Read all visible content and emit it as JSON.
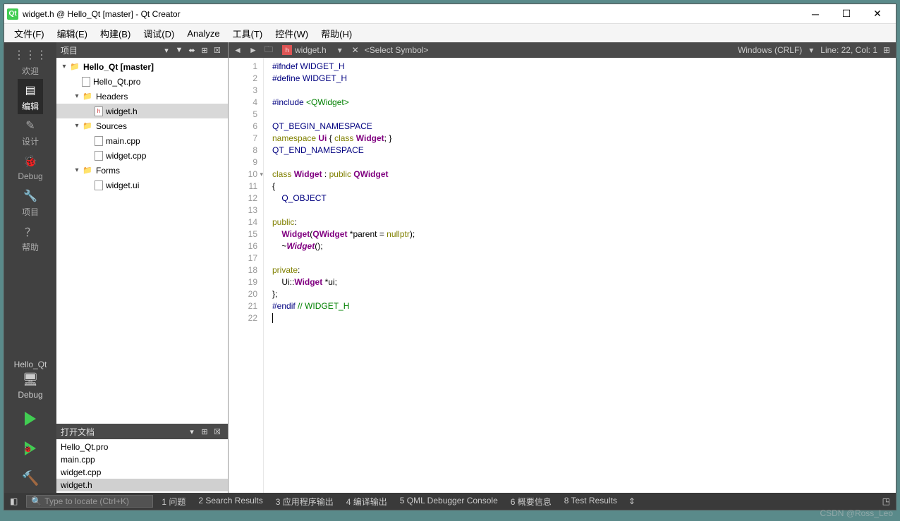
{
  "title": "widget.h @ Hello_Qt [master] - Qt Creator",
  "menus": [
    "文件(F)",
    "编辑(E)",
    "构建(B)",
    "调试(D)",
    "Analyze",
    "工具(T)",
    "控件(W)",
    "帮助(H)"
  ],
  "leftbar": {
    "items": [
      {
        "label": "欢迎",
        "icon": "⋮⋮⋮"
      },
      {
        "label": "编辑",
        "icon": "▤",
        "active": true
      },
      {
        "label": "设计",
        "icon": "✎"
      },
      {
        "label": "Debug",
        "icon": "🐞"
      },
      {
        "label": "项目",
        "icon": "🔧"
      },
      {
        "label": "帮助",
        "icon": "？"
      }
    ],
    "project": "Hello_Qt",
    "config": "Debug"
  },
  "project_panel": {
    "title": "项目",
    "tree": [
      {
        "depth": 0,
        "arrow": "▾",
        "icon": "folder",
        "label": "Hello_Qt [master]",
        "bold": true
      },
      {
        "depth": 1,
        "arrow": "",
        "icon": "file",
        "label": "Hello_Qt.pro"
      },
      {
        "depth": 1,
        "arrow": "▾",
        "icon": "folder",
        "label": "Headers"
      },
      {
        "depth": 2,
        "arrow": "",
        "icon": "hfile",
        "label": "widget.h",
        "selected": true
      },
      {
        "depth": 1,
        "arrow": "▾",
        "icon": "folder",
        "label": "Sources"
      },
      {
        "depth": 2,
        "arrow": "",
        "icon": "file",
        "label": "main.cpp"
      },
      {
        "depth": 2,
        "arrow": "",
        "icon": "file",
        "label": "widget.cpp"
      },
      {
        "depth": 1,
        "arrow": "▾",
        "icon": "folder",
        "label": "Forms"
      },
      {
        "depth": 2,
        "arrow": "",
        "icon": "file",
        "label": "widget.ui"
      }
    ]
  },
  "open_docs": {
    "title": "打开文档",
    "items": [
      "Hello_Qt.pro",
      "main.cpp",
      "widget.cpp",
      "widget.h"
    ],
    "selected": "widget.h"
  },
  "tab": {
    "filename": "widget.h",
    "symbol": "<Select Symbol>",
    "encoding": "Windows (CRLF)",
    "position": "Line: 22, Col: 1"
  },
  "code_lines": [
    {
      "n": 1,
      "html": "<span class='pp'>#ifndef</span><span class='ppk'> WIDGET_H</span>"
    },
    {
      "n": 2,
      "html": "<span class='pp'>#define</span><span class='ppk'> WIDGET_H</span>"
    },
    {
      "n": 3,
      "html": ""
    },
    {
      "n": 4,
      "html": "<span class='pp'>#include</span> <span class='str'>&lt;QWidget&gt;</span>"
    },
    {
      "n": 5,
      "html": ""
    },
    {
      "n": 6,
      "html": "<span class='ppk'>QT_BEGIN_NAMESPACE</span>"
    },
    {
      "n": 7,
      "html": "<span class='kw'>namespace</span> <span class='cls'>Ui</span> { <span class='kw'>class</span> <span class='cls'>Widget</span>; }"
    },
    {
      "n": 8,
      "html": "<span class='ppk'>QT_END_NAMESPACE</span>"
    },
    {
      "n": 9,
      "html": ""
    },
    {
      "n": 10,
      "html": "<span class='kw'>class</span> <span class='cls'>Widget</span> : <span class='kw'>public</span> <span class='cls'>QWidget</span>",
      "fold": true
    },
    {
      "n": 11,
      "html": "{"
    },
    {
      "n": 12,
      "html": "    <span class='ppk'>Q_OBJECT</span>"
    },
    {
      "n": 13,
      "html": ""
    },
    {
      "n": 14,
      "html": "<span class='kw'>public</span>:"
    },
    {
      "n": 15,
      "html": "    <span class='cls'>Widget</span>(<span class='cls'>QWidget</span> *parent = <span class='kw'>nullptr</span>);"
    },
    {
      "n": 16,
      "html": "    ~<span class='cls-i'>Widget</span>();"
    },
    {
      "n": 17,
      "html": ""
    },
    {
      "n": 18,
      "html": "<span class='kw'>private</span>:"
    },
    {
      "n": 19,
      "html": "    Ui::<span class='cls'>Widget</span> *ui;"
    },
    {
      "n": 20,
      "html": "};"
    },
    {
      "n": 21,
      "html": "<span class='pp'>#endif</span> <span class='cmt'>// WIDGET_H</span>"
    },
    {
      "n": 22,
      "html": "<span class='cursor'></span>"
    }
  ],
  "statusbar": {
    "search_placeholder": "Type to locate (Ctrl+K)",
    "tabs": [
      "1 问题",
      "2 Search Results",
      "3 应用程序输出",
      "4 编译输出",
      "5 QML Debugger Console",
      "6 概要信息",
      "8 Test Results"
    ]
  },
  "watermark": "CSDN @Ross_Leo"
}
